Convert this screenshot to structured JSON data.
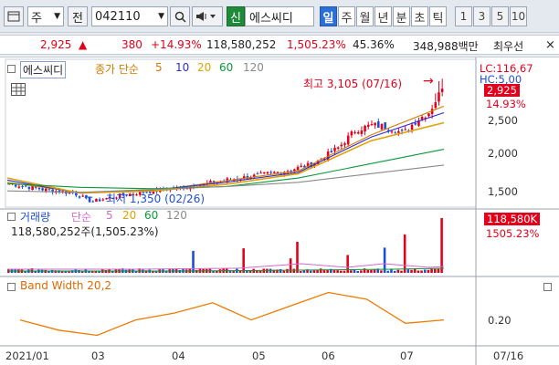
{
  "toolbar": {
    "market_select": "주",
    "prev_label": "전",
    "code_value": "042110",
    "search_icon_glyph": "🔍",
    "sound_icon_glyph": "◀",
    "shin_label": "신",
    "stock_name": "에스씨디",
    "periods": [
      "일",
      "주",
      "월",
      "년",
      "분",
      "초",
      "틱"
    ],
    "active_period": "일",
    "numbers": [
      "1",
      "3",
      "5",
      "10"
    ]
  },
  "quote": {
    "price": "2,925",
    "direction_glyph": "▲",
    "change": "380",
    "change_pct": "+14.93%",
    "volume": "118,580,252",
    "volume_ratio": "1,505.23%",
    "turnover": "45.36%",
    "amount": "348,988백만",
    "best_ask_label": "최우선",
    "close_glyph": "×"
  },
  "price_panel": {
    "stock_label": "에스씨디",
    "ma_label": "종가 단순",
    "ma_periods": [
      "5",
      "10",
      "20",
      "60",
      "120"
    ],
    "lc_label": "LC:116,67",
    "hc_label": "HC:5,00",
    "price_tag": "2,925",
    "change_pct_tag": "14.93%",
    "high_annotation": "최고 3,105 (07/16)",
    "low_annotation": "최저 1,350 (02/26)",
    "y_ticks": [
      "2,500",
      "2,000",
      "1,500"
    ]
  },
  "volume_panel": {
    "label": "거래량",
    "ma_label": "단순",
    "ma_periods": [
      "5",
      "20",
      "60",
      "120"
    ],
    "value_text": "118,580,252주(1,505.23%)",
    "tag_volume": "118,580K",
    "tag_pct": "1505.23%"
  },
  "bw_panel": {
    "label": "Band Width 20,2",
    "tick": "0.20"
  },
  "x_axis": {
    "labels": [
      "2021/01",
      "03",
      "04",
      "05",
      "06",
      "07"
    ],
    "current_date": "07/16"
  },
  "colors": {
    "up": "#e3001b",
    "down": "#1d4fd6",
    "ma5": "#d17a00",
    "ma10": "#2c2cd6",
    "ma20": "#e0a000",
    "ma60": "#0a9a3a",
    "ma120": "#8a8a8a",
    "bandwidth": "#f07a00",
    "active_tab": "#2d6fd8"
  },
  "chart_data": [
    {
      "type": "line",
      "title": "에스씨디",
      "subtitle": "종가 단순 5 10 20 60 120",
      "x": [
        "2021/01",
        "03",
        "04",
        "05",
        "06",
        "07"
      ],
      "series": [
        {
          "name": "5",
          "values": [
            1620,
            1480,
            1500,
            1640,
            1780,
            2280,
            2680
          ]
        },
        {
          "name": "10",
          "values": [
            1650,
            1470,
            1510,
            1620,
            1760,
            2250,
            2590
          ]
        },
        {
          "name": "20",
          "values": [
            1680,
            1470,
            1500,
            1590,
            1740,
            2200,
            2450
          ]
        },
        {
          "name": "60",
          "values": [
            1600,
            1550,
            1530,
            1560,
            1680,
            1880,
            2080
          ]
        },
        {
          "name": "120",
          "values": [
            1500,
            1480,
            1520,
            1560,
            1620,
            1740,
            1860
          ]
        }
      ],
      "ylim": [
        1350,
        3105
      ],
      "annotations": [
        "최고 3,105 (07/16)",
        "최저 1,350 (02/26)"
      ]
    },
    {
      "type": "bar",
      "title": "거래량",
      "values_text": "118,580,252주(1,505.23%)"
    },
    {
      "type": "line",
      "title": "Band Width 20,2",
      "values": [
        0.18,
        0.12,
        0.09,
        0.18,
        0.22,
        0.28,
        0.18,
        0.26,
        0.34,
        0.3,
        0.16,
        0.18
      ]
    }
  ]
}
